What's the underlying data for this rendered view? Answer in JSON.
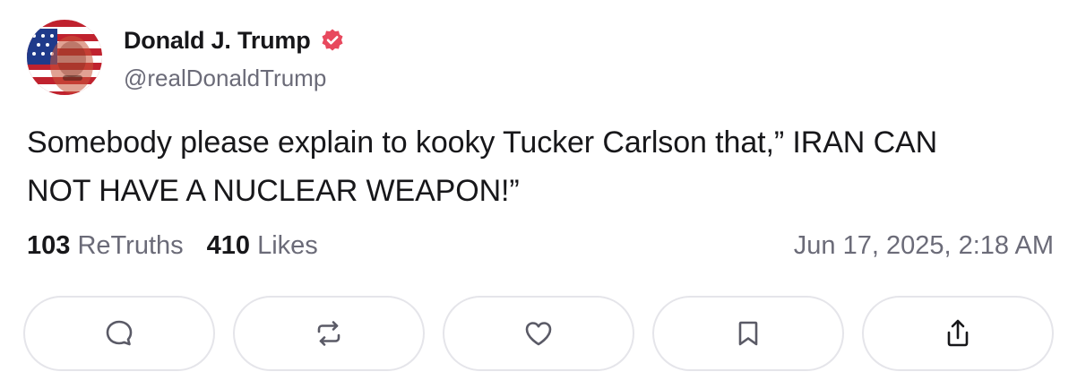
{
  "author": {
    "display_name": "Donald J. Trump",
    "handle": "@realDonaldTrump",
    "verified_badge_color": "#e8495e",
    "avatar_icon": "avatar-flag-portrait"
  },
  "post": {
    "text_line_1": "Somebody please explain to kooky Tucker Carlson that,” IRAN CAN",
    "text_line_2": "NOT HAVE A NUCLEAR WEAPON!”"
  },
  "stats": {
    "retruths_count": "103",
    "retruths_label": "ReTruths",
    "likes_count": "410",
    "likes_label": "Likes"
  },
  "timestamp": "Jun 17, 2025, 2:18 AM",
  "actions": [
    {
      "icon": "reply-icon"
    },
    {
      "icon": "retruth-icon"
    },
    {
      "icon": "like-heart-icon"
    },
    {
      "icon": "bookmark-icon"
    },
    {
      "icon": "share-icon"
    }
  ],
  "colors": {
    "text_primary": "#17171a",
    "text_secondary": "#6b6b78",
    "border": "#e5e5ea",
    "icon": "#5a5a66"
  }
}
